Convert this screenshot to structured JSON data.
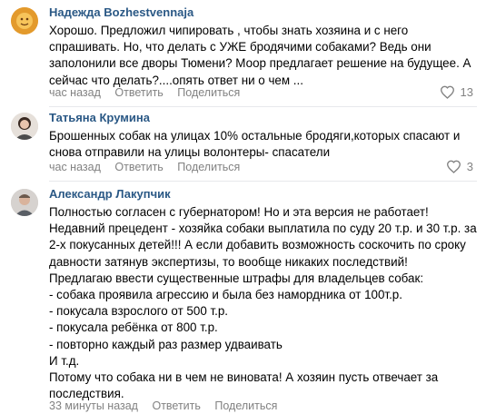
{
  "comments": [
    {
      "author": "Надежда Bozhestvennaja",
      "lines": [
        "Хорошо. Предложил чипировать , чтобы знать хозяина и с него",
        "спрашивать. Но, что делать с УЖЕ бродячими собаками? Ведь они",
        "заполонили все дворы Тюмени? Моор предлагает решение на будущее. А",
        "сейчас что делать?....опять ответ ни о чем ..."
      ],
      "time": "час назад",
      "reply_label": "Ответить",
      "share_label": "Поделиться",
      "likes": "13"
    },
    {
      "author": "Татьяна Крумина",
      "lines": [
        "Брошенных собак на улицах 10% остальные бродяги,которых спасают и",
        "снова отправили на улицы волонтеры- спасатели"
      ],
      "time": "час назад",
      "reply_label": "Ответить",
      "share_label": "Поделиться",
      "likes": "3"
    },
    {
      "author": "Александр Лакупчик",
      "lines": [
        "Полностью согласен с губернатором! Но и эта версия не работает!",
        "Недавний прецедент - хозяйка собаки выплатила по суду 20 т.р. и 30 т.р. за",
        "2-х покусанных детей!!! А если добавить возможность соскочить по сроку",
        "давности затянув экспертизы, то вообще никаких последствий!",
        "Предлагаю ввести существенные штрафы для владельцев собак:",
        "- собака проявила агрессию и была без намордника от 100т.р.",
        "- покусала взрослого от 500 т.р.",
        "- покусала ребёнка от 800 т.р.",
        "- повторно каждый раз размер удваивать",
        "И т.д.",
        "Потому что собака ни в чем не виновата! А хозяин пусть отвечает за",
        "последствия."
      ],
      "time": "33 минуты назад",
      "reply_label": "Ответить",
      "share_label": "Поделиться"
    }
  ],
  "colors": {
    "author": "#2a5885",
    "meta": "#828282",
    "divider": "#e7e8ec"
  }
}
